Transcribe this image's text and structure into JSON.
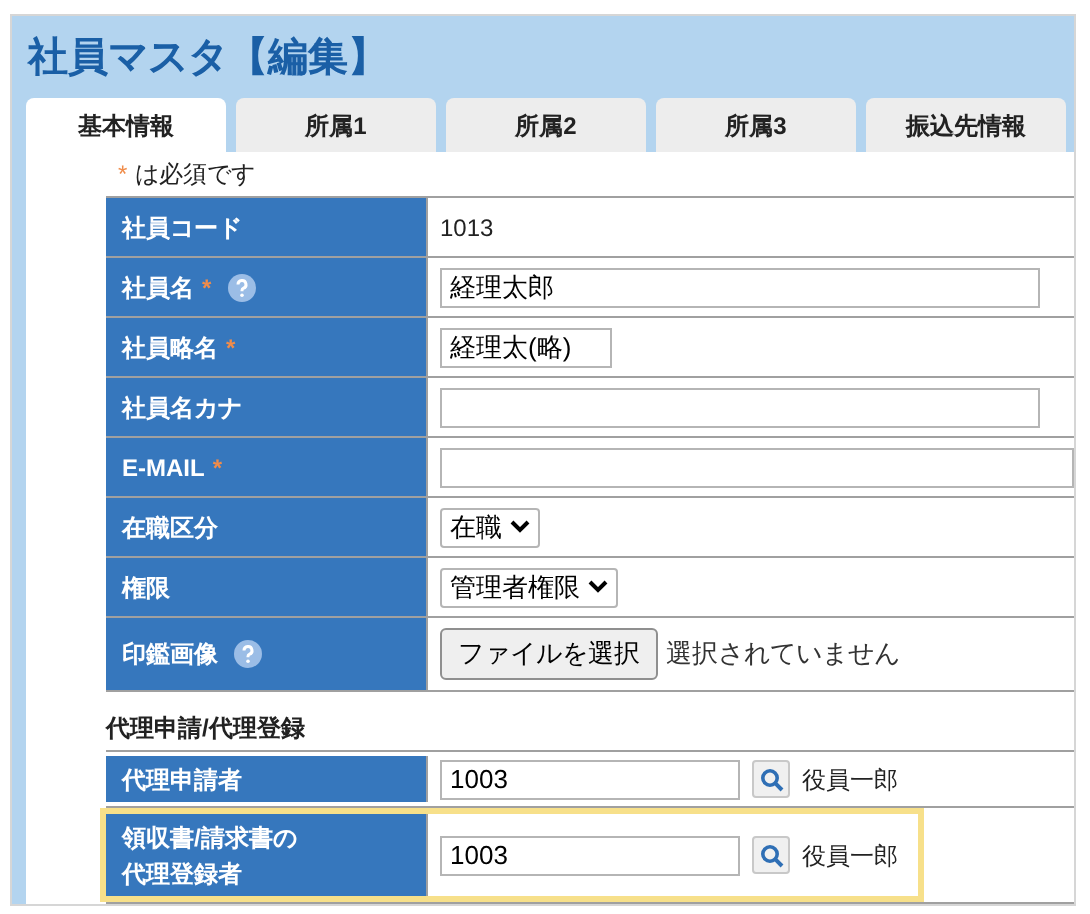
{
  "title": "社員マスタ【編集】",
  "tabs": [
    {
      "label": "基本情報",
      "selected": true
    },
    {
      "label": "所属1",
      "selected": false
    },
    {
      "label": "所属2",
      "selected": false
    },
    {
      "label": "所属3",
      "selected": false
    },
    {
      "label": "振込先情報",
      "selected": false
    }
  ],
  "required_note": {
    "mark": "*",
    "text": "は必須です"
  },
  "fields": [
    {
      "label": "社員コード",
      "required": false,
      "help": false,
      "kind": "text",
      "value": "1013"
    },
    {
      "label": "社員名",
      "required": true,
      "help": true,
      "kind": "longinput",
      "value": "経理太郎"
    },
    {
      "label": "社員略名",
      "required": true,
      "help": false,
      "kind": "shortinput",
      "value": "経理太(略)"
    },
    {
      "label": "社員名カナ",
      "required": false,
      "help": false,
      "kind": "longinput"
    },
    {
      "label": "E-MAIL",
      "required": true,
      "help": false,
      "kind": "wideinput"
    },
    {
      "label": "在職区分",
      "required": false,
      "help": false,
      "kind": "select",
      "value": "在職"
    },
    {
      "label": "権限",
      "required": false,
      "help": false,
      "kind": "select",
      "value": "管理者権限"
    },
    {
      "label": "印鑑画像",
      "required": false,
      "help": true,
      "kind": "file",
      "button": "ファイルを選択",
      "status": "選択されていません"
    }
  ],
  "proxy_section": {
    "title": "代理申請/代理登録",
    "rows": [
      {
        "label_lines": [
          "代理申請者"
        ],
        "value": "1003",
        "name": "役員一郎",
        "highlighted": false
      },
      {
        "label_lines": [
          "領収書/請求書の",
          "代理登録者"
        ],
        "value": "1003",
        "name": "役員一郎",
        "highlighted": true
      }
    ]
  }
}
